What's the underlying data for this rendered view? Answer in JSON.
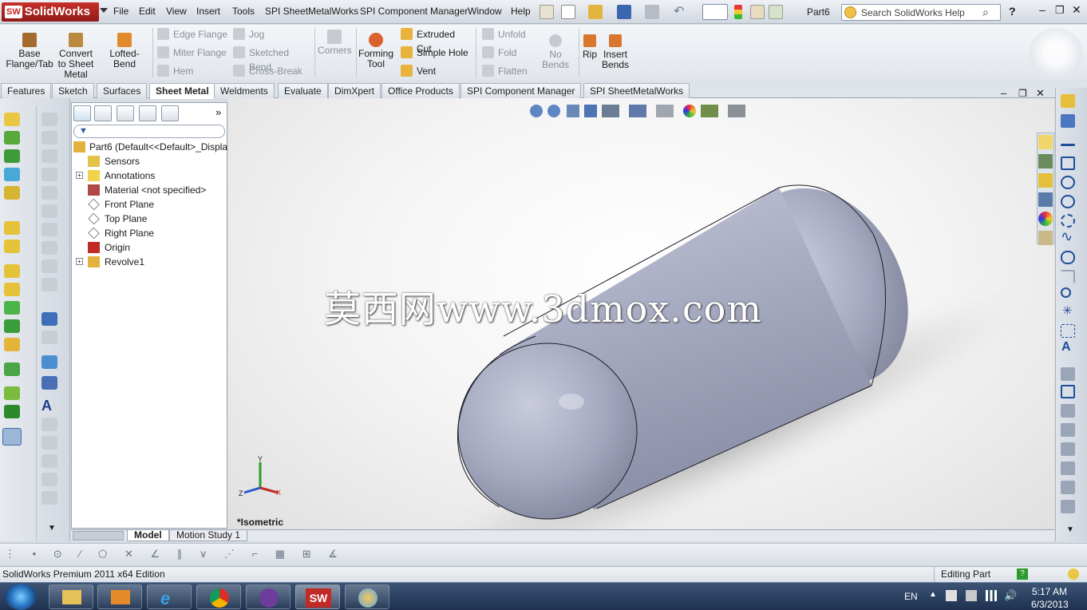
{
  "app": {
    "name": "SolidWorks",
    "document": "Part6"
  },
  "menu": [
    "File",
    "Edit",
    "View",
    "Insert",
    "Tools",
    "SPI SheetMetalWorks",
    "SPI Component Manager",
    "Window",
    "Help"
  ],
  "search": {
    "placeholder": "Search SolidWorks Help"
  },
  "ribbon": {
    "base_flange": "Base Flange/Tab",
    "convert": "Convert to Sheet Metal",
    "lofted": "Lofted-Bend",
    "edge_flange": "Edge Flange",
    "miter_flange": "Miter Flange",
    "hem": "Hem",
    "jog": "Jog",
    "sketched_bend": "Sketched Bend",
    "cross_break": "Cross-Break",
    "corners": "Corners",
    "forming_tool": "Forming Tool",
    "extruded_cut": "Extruded Cut",
    "simple_hole": "Simple Hole",
    "vent": "Vent",
    "unfold": "Unfold",
    "fold": "Fold",
    "flatten": "Flatten",
    "no_bends": "No Bends",
    "rip": "Rip",
    "insert_bends": "Insert Bends"
  },
  "tabs": [
    "Features",
    "Sketch",
    "Surfaces",
    "Sheet Metal",
    "Weldments",
    "Evaluate",
    "DimXpert",
    "Office Products",
    "SPI Component Manager",
    "SPI SheetMetalWorks"
  ],
  "active_tab": "Sheet Metal",
  "tree": {
    "root": "Part6  (Default<<Default>_Displa",
    "items": [
      {
        "label": "Sensors",
        "icon": "sensor-icon"
      },
      {
        "label": "Annotations",
        "icon": "annotation-icon"
      },
      {
        "label": "Material <not specified>",
        "icon": "material-icon"
      },
      {
        "label": "Front Plane",
        "icon": "plane-icon"
      },
      {
        "label": "Top Plane",
        "icon": "plane-icon"
      },
      {
        "label": "Right Plane",
        "icon": "plane-icon"
      },
      {
        "label": "Origin",
        "icon": "origin-icon"
      },
      {
        "label": "Revolve1",
        "icon": "revolve-icon"
      }
    ]
  },
  "viewport": {
    "watermark": "莫西网www.3dmox.com",
    "view_label": "*Isometric",
    "triad": {
      "x": "X",
      "y": "Y",
      "z": "Z"
    }
  },
  "bottom_tabs": [
    "Model",
    "Motion Study 1"
  ],
  "status": {
    "left": "SolidWorks Premium 2011 x64 Edition",
    "mode": "Editing Part"
  },
  "taskbar": {
    "lang": "EN",
    "time": "5:17 AM",
    "date": "6/3/2013"
  },
  "colors": {
    "accent": "#c22a26",
    "part": "#a9adc2",
    "selection": "#2a65b8"
  }
}
